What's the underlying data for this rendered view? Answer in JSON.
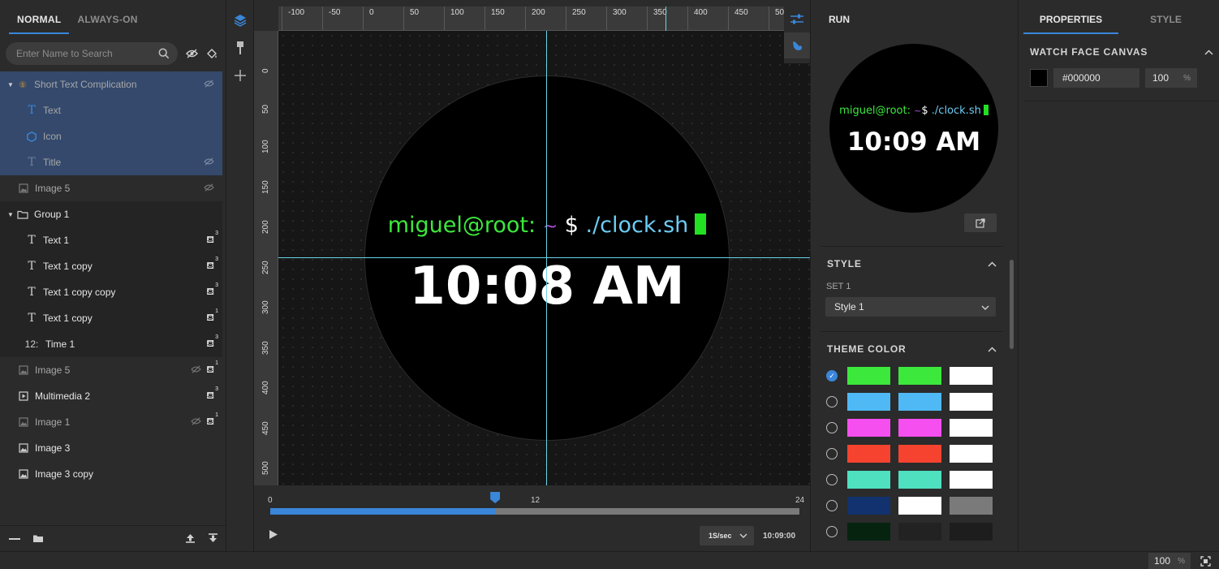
{
  "left_panel": {
    "tabs": [
      "NORMAL",
      "ALWAYS-ON"
    ],
    "search_placeholder": "Enter Name to Search",
    "layers": [
      {
        "name": "Short Text Complication",
        "icon": "complication-icon",
        "hidden": true
      },
      {
        "name": "Text",
        "icon": "text-icon"
      },
      {
        "name": "Icon",
        "icon": "hexagon-icon"
      },
      {
        "name": "Title",
        "icon": "text-icon",
        "hidden": true
      },
      {
        "name": "Image 5",
        "icon": "image-icon",
        "hidden": true
      },
      {
        "name": "Group 1",
        "icon": "folder-icon"
      },
      {
        "name": "Text 1",
        "icon": "text-icon",
        "badge": "3"
      },
      {
        "name": "Text 1 copy",
        "icon": "text-icon",
        "badge": "3"
      },
      {
        "name": "Text 1 copy copy",
        "icon": "text-icon",
        "badge": "3"
      },
      {
        "name": "Text 1 copy",
        "icon": "text-icon",
        "badge": "1"
      },
      {
        "name": "Time 1",
        "icon": "time-icon",
        "icon_text": "12:",
        "badge": "3"
      },
      {
        "name": "Image 5",
        "icon": "image-icon",
        "hidden": true,
        "badge": "1"
      },
      {
        "name": "Multimedia 2",
        "icon": "multimedia-icon",
        "badge": "3"
      },
      {
        "name": "Image 1",
        "icon": "image-icon",
        "hidden": true,
        "badge": "1"
      },
      {
        "name": "Image 3",
        "icon": "image-icon"
      },
      {
        "name": "Image 3 copy",
        "icon": "image-icon"
      }
    ]
  },
  "ruler": {
    "top_ticks": [
      "-100",
      "-50",
      "0",
      "50",
      "100",
      "150",
      "200",
      "250",
      "300",
      "350",
      "400",
      "450",
      "50"
    ],
    "left_ticks": [
      "0",
      "50",
      "100",
      "150",
      "200",
      "250",
      "300",
      "350",
      "400",
      "450",
      "500"
    ]
  },
  "watch": {
    "prompt_user": "miguel@root:",
    "prompt_tilde": "~",
    "prompt_dollar": "$",
    "prompt_cmd": "./clock.sh",
    "time": "10:08 AM"
  },
  "timeline": {
    "start": "0",
    "mid": "12",
    "end": "24",
    "progress": 0.425,
    "speed": "1S/sec",
    "time": "10:09:00"
  },
  "run_panel": {
    "title": "RUN",
    "preview_prompt_user": "miguel@root:",
    "preview_prompt_tilde": "~",
    "preview_prompt_dollar": "$",
    "preview_prompt_cmd": "./clock.sh",
    "preview_time": "10:09 AM",
    "style_header": "STYLE",
    "set_label": "SET 1",
    "style_value": "Style 1",
    "theme_header": "THEME COLOR",
    "themes": [
      {
        "selected": true,
        "colors": [
          "#3ce83c",
          "#3ce83c",
          "#ffffff"
        ]
      },
      {
        "selected": false,
        "colors": [
          "#4fb9f5",
          "#4fb9f5",
          "#ffffff"
        ]
      },
      {
        "selected": false,
        "colors": [
          "#f54ff0",
          "#f54ff0",
          "#ffffff"
        ]
      },
      {
        "selected": false,
        "colors": [
          "#f5432f",
          "#f5432f",
          "#ffffff"
        ]
      },
      {
        "selected": false,
        "colors": [
          "#4fe0c0",
          "#4fe0c0",
          "#ffffff"
        ]
      },
      {
        "selected": false,
        "colors": [
          "#11326e",
          "#ffffff",
          "#7a7a7a"
        ]
      },
      {
        "selected": false,
        "colors": [
          "#062310",
          "#222222",
          "#1d1d1d"
        ]
      }
    ]
  },
  "properties": {
    "tabs": [
      "PROPERTIES",
      "STYLE"
    ],
    "section": "WATCH FACE CANVAS",
    "color_hex": "#000000",
    "opacity": "100",
    "opacity_unit": "%"
  },
  "status": {
    "zoom": "100",
    "zoom_unit": "%"
  },
  "colors": {
    "accent": "#3a86d9",
    "prompt_green": "#3ce83c",
    "prompt_tilde": "#b04fd8",
    "prompt_cmd": "#6ccdf5",
    "cursor": "#22e022",
    "guide": "#6bd4e6"
  }
}
